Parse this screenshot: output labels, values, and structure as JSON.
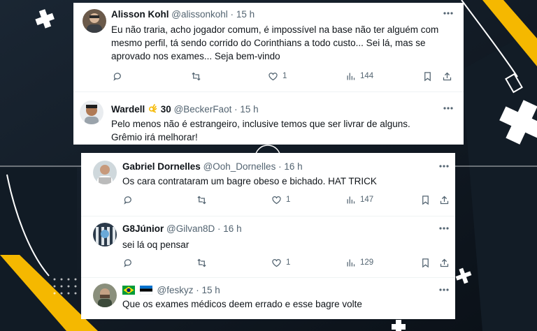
{
  "colors": {
    "background": "#0e1620",
    "accent_yellow": "#f5b800",
    "card": "#ffffff",
    "text": "#0f1419",
    "muted": "#536471"
  },
  "card1": {
    "tweets": [
      {
        "name": "Alisson Kohl",
        "handle": "@alissonkohl",
        "dot": "·",
        "time": "15 h",
        "text": "Eu não traria, acho jogador comum, é impossível na base não ter alguém com mesmo perfil, tá sendo corrido do Corinthians a todo custo... Sei lá, mas se aprovado nos exames... Seja bem-vindo",
        "likes": "1",
        "views": "144"
      },
      {
        "name": "Wardell",
        "name_emoji_text": "30",
        "handle": "@BeckerFaot",
        "dot": "·",
        "time": "15 h",
        "text": "Pelo menos não é estrangeiro, inclusive temos que ser livrar de alguns. Grêmio irá melhorar!"
      }
    ]
  },
  "card2": {
    "tweets": [
      {
        "name": "Gabriel Dornelles",
        "handle": "@Ooh_Dornelles",
        "dot": "·",
        "time": "16 h",
        "text": "Os cara contrataram um bagre obeso e bichado. HAT TRICK",
        "likes": "1",
        "views": "147"
      },
      {
        "name": "G8Júnior",
        "handle": "@Gilvan8D",
        "dot": "·",
        "time": "16 h",
        "text": "sei lá oq pensar",
        "likes": "1",
        "views": "129"
      },
      {
        "handle": "@feskyz",
        "dot": "·",
        "time": "15 h",
        "text": "Que os exames médicos deem errado e esse bagre volte",
        "flags": [
          "brazil-flag-icon",
          "estonia-flag-icon"
        ]
      }
    ]
  },
  "icons": [
    "reply-icon",
    "retweet-icon",
    "heart-icon",
    "views-icon",
    "bookmark-icon",
    "share-icon",
    "more-icon"
  ]
}
